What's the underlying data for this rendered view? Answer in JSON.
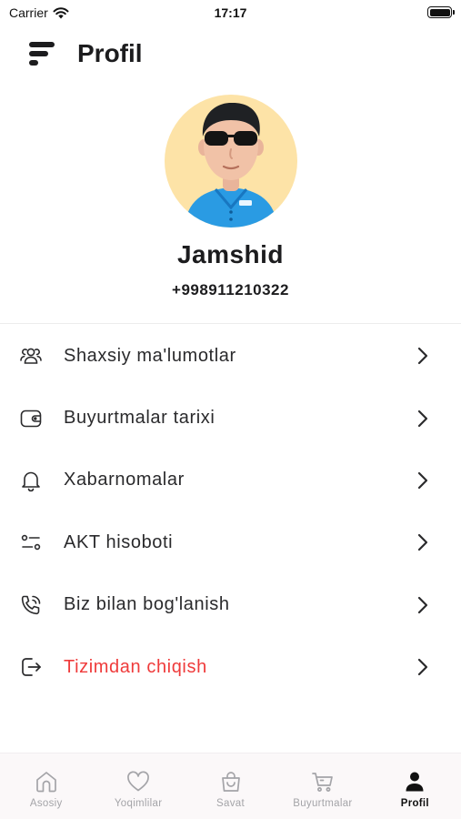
{
  "status_bar": {
    "carrier": "Carrier",
    "time": "17:17"
  },
  "header": {
    "title": "Profil",
    "logo_icon": "menu-logo-icon"
  },
  "profile": {
    "name": "Jamshid",
    "phone": "+998911210322",
    "avatar_bg": "#fde3a7"
  },
  "menu": {
    "items": [
      {
        "label": "Shaxsiy ma'lumotlar",
        "icon": "users-icon"
      },
      {
        "label": "Buyurtmalar tarixi",
        "icon": "wallet-icon"
      },
      {
        "label": "Xabarnomalar",
        "icon": "bell-icon"
      },
      {
        "label": "AKT hisoboti",
        "icon": "filter-sliders-icon"
      },
      {
        "label": "Biz bilan bog'lanish",
        "icon": "phone-call-icon"
      },
      {
        "label": "Tizimdan chiqish",
        "icon": "logout-icon",
        "color": "#ef3b3b"
      }
    ]
  },
  "tab_bar": {
    "tabs": [
      {
        "label": "Asosiy",
        "icon": "home-icon",
        "active": false
      },
      {
        "label": "Yoqimlilar",
        "icon": "heart-icon",
        "active": false
      },
      {
        "label": "Savat",
        "icon": "bag-icon",
        "active": false
      },
      {
        "label": "Buyurtmalar",
        "icon": "cart-icon",
        "active": false
      },
      {
        "label": "Profil",
        "icon": "person-icon",
        "active": true
      }
    ]
  },
  "colors": {
    "danger": "#ef3b3b",
    "text": "#1c1c1e",
    "tab_inactive": "#a4a4a8",
    "tab_bar_bg": "#fbf8f9"
  }
}
